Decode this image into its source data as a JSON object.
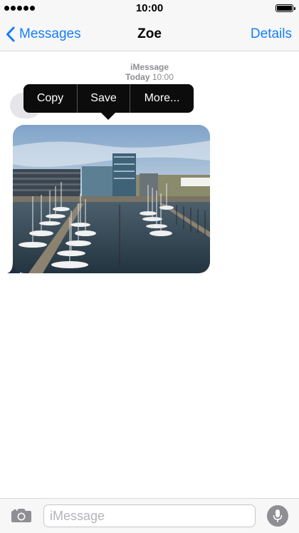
{
  "status_bar": {
    "time": "10:00",
    "signal_bars": 5,
    "battery_level": 1.0
  },
  "nav": {
    "back_label": "Messages",
    "title": "Zoe",
    "details_label": "Details"
  },
  "conversation": {
    "service": "iMessage",
    "day": "Today",
    "time": "10:00",
    "messages": [
      {
        "type": "image",
        "icon": "harbor-photo",
        "direction": "incoming"
      }
    ]
  },
  "context_menu": {
    "items": [
      "Copy",
      "Save",
      "More..."
    ]
  },
  "compose": {
    "placeholder": "iMessage",
    "value": ""
  },
  "colors": {
    "accent": "#147efb",
    "bubble_incoming": "#e5e5ea",
    "menu_bg": "#0c0c0c",
    "bar_bg": "#f7f7f7"
  }
}
